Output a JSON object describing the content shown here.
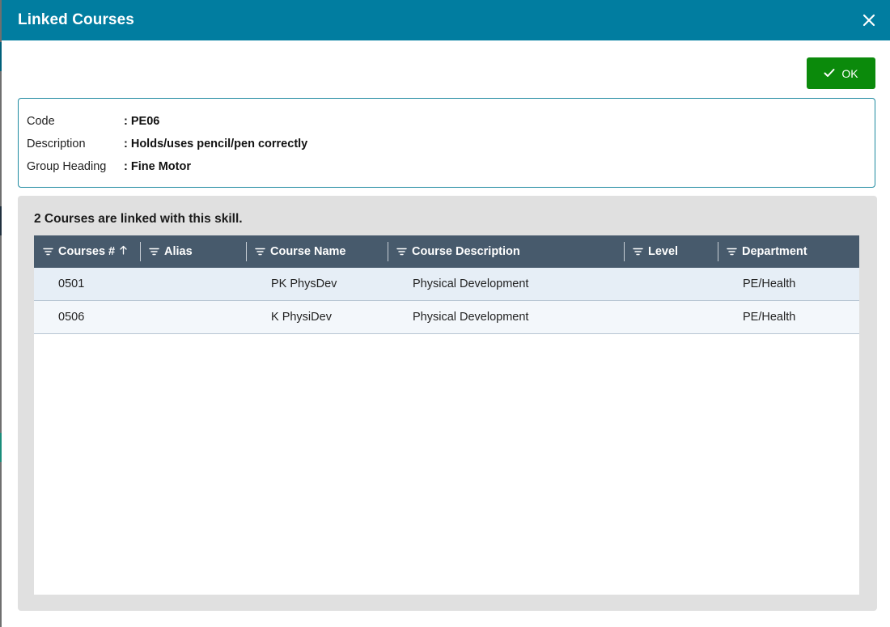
{
  "dialog": {
    "title": "Linked Courses"
  },
  "ok_button": {
    "label": "OK"
  },
  "skill_info": {
    "rows": [
      {
        "label": "Code",
        "value": ": PE06"
      },
      {
        "label": "Description",
        "value": ": Holds/uses pencil/pen correctly"
      },
      {
        "label": "Group Heading",
        "value": ": Fine Motor"
      }
    ]
  },
  "courses_panel": {
    "summary": "2 Courses are linked with this skill.",
    "columns": [
      {
        "label": "Courses #",
        "sort": "ascending"
      },
      {
        "label": "Alias"
      },
      {
        "label": "Course Name"
      },
      {
        "label": "Course Description"
      },
      {
        "label": "Level"
      },
      {
        "label": "Department"
      }
    ],
    "rows": [
      {
        "course_no": "0501",
        "alias": "",
        "name": "PK PhysDev",
        "description": "Physical Development",
        "level": "",
        "department": "PE/Health"
      },
      {
        "course_no": "0506",
        "alias": "",
        "name": "K PhysiDev",
        "description": "Physical Development",
        "level": "",
        "department": "PE/Health"
      }
    ]
  },
  "icons": {
    "close": "close-icon",
    "ok": "checkmark-icon",
    "filter": "filter-icon",
    "sort": "sort-ascending-icon"
  },
  "colors": {
    "title_bar": "#017da0",
    "ok_button": "#0b8a0b",
    "grid_header": "#475a6c",
    "row_alt_1": "#e6eef6",
    "row_alt_2": "#f3f7fb"
  }
}
